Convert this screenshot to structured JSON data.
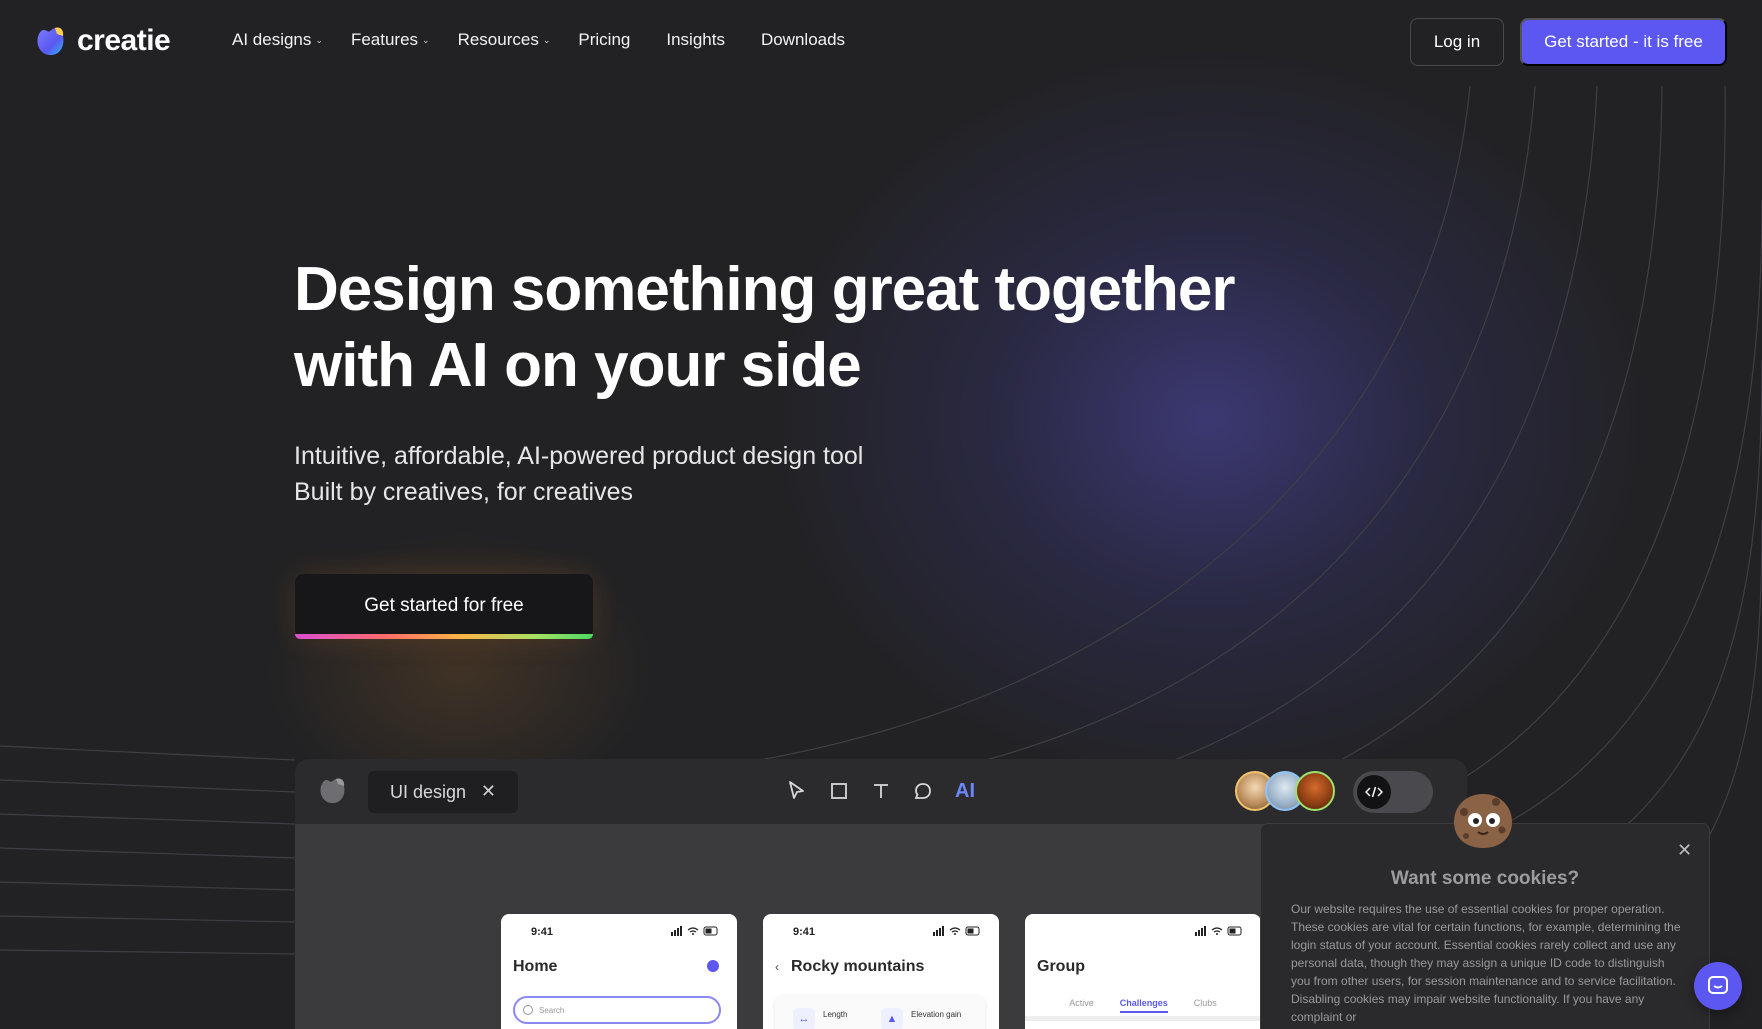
{
  "brand": {
    "name": "creatie",
    "accent": "#5b57f0"
  },
  "nav": {
    "links": [
      {
        "label": "AI designs",
        "dropdown": true
      },
      {
        "label": "Features",
        "dropdown": true
      },
      {
        "label": "Resources",
        "dropdown": true
      },
      {
        "label": "Pricing",
        "dropdown": false
      },
      {
        "label": "Insights",
        "dropdown": false
      },
      {
        "label": "Downloads",
        "dropdown": false
      }
    ],
    "login_label": "Log in",
    "cta_label": "Get started - it is free"
  },
  "hero": {
    "title_line1": "Design something great together",
    "title_line2": "with AI on your side",
    "subtitle_line1": "Intuitive, affordable, AI-powered product design tool",
    "subtitle_line2": "Built by creatives, for creatives",
    "cta_label": "Get started for free"
  },
  "app_preview": {
    "tab_label": "UI design",
    "tools": [
      "cursor-icon",
      "rectangle-icon",
      "text-icon",
      "comment-icon",
      "ai-icon"
    ],
    "ai_label": "AI",
    "phones": [
      {
        "time": "9:41",
        "title": "Home",
        "search_placeholder": "Search"
      },
      {
        "time": "9:41",
        "title": "Rocky mountains",
        "stat1": "Length",
        "stat2": "Elevation gain"
      },
      {
        "time": "",
        "title": "Group",
        "tabs": [
          "Active",
          "Challenges",
          "Clubs"
        ]
      }
    ]
  },
  "cookie": {
    "title": "Want some cookies?",
    "text": "Our website requires the use of essential cookies for proper operation. These cookies are vital for certain functions, for example, determining the login status of your account. Essential cookies rarely collect and use any personal data, though they may assign a unique ID code to distinguish you from other users, for session maintenance and to service facilitation. Disabling cookies may impair website functionality. If you have any complaint or"
  }
}
